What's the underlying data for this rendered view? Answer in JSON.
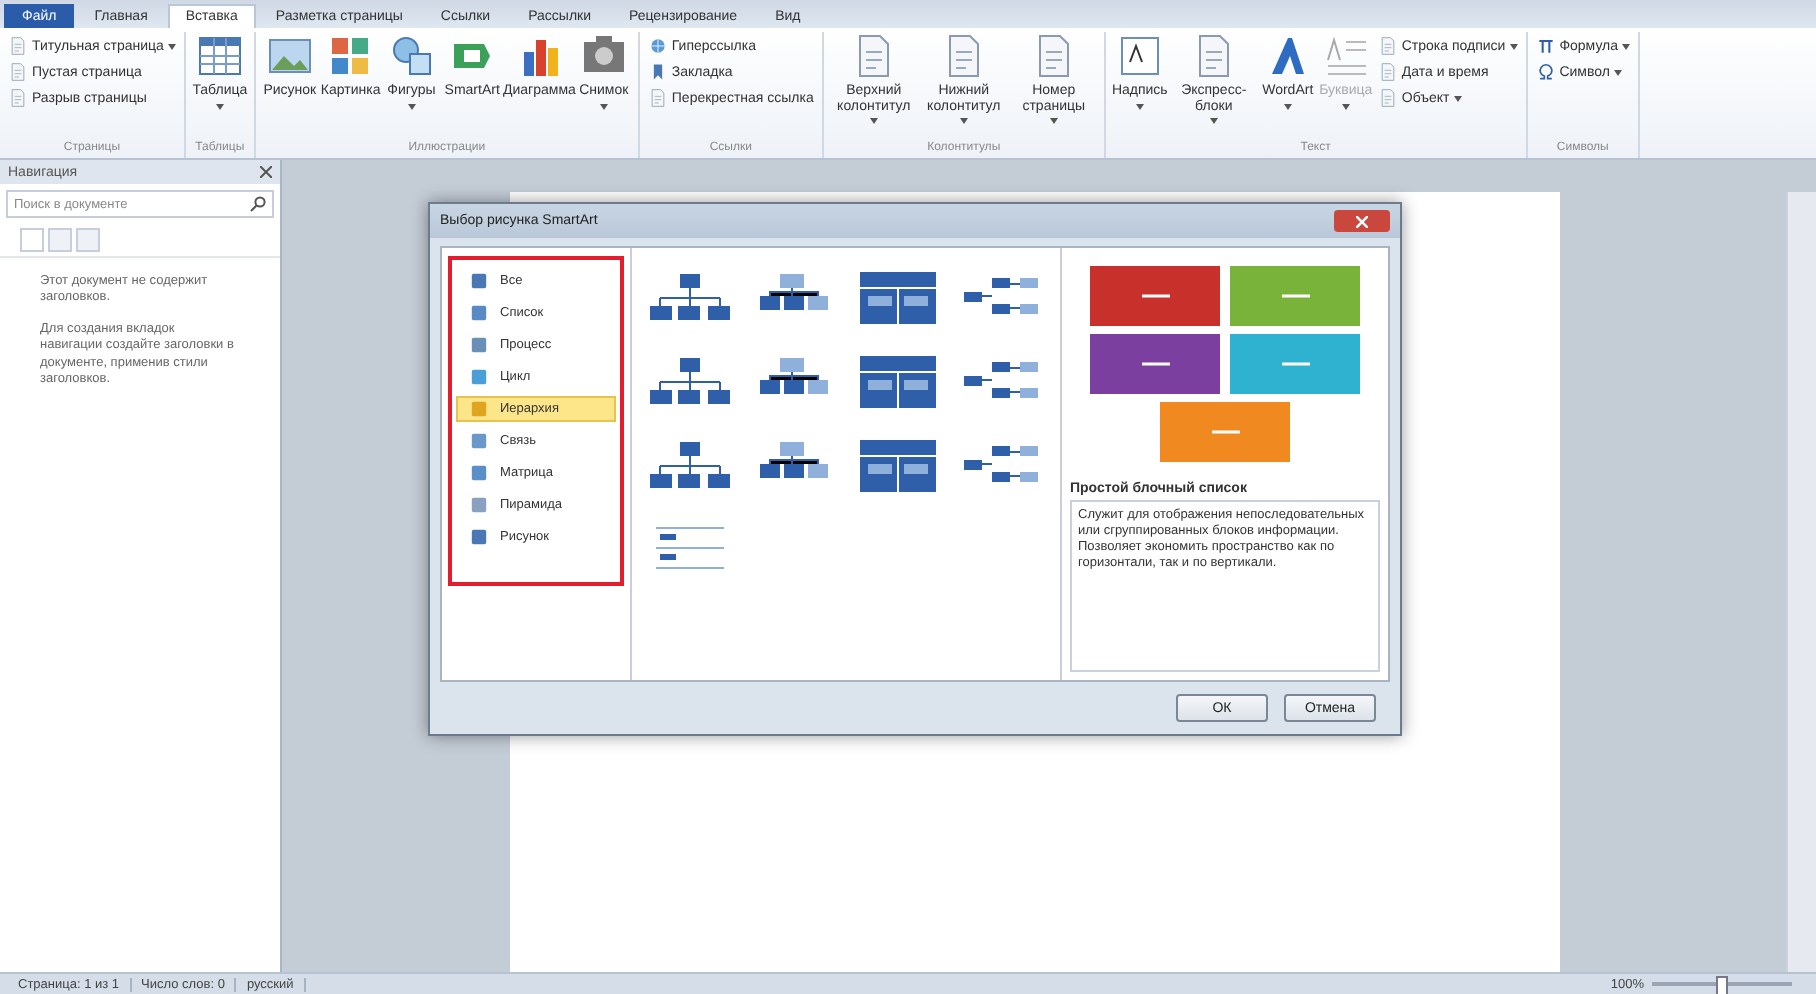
{
  "tabs": [
    {
      "label": "Файл",
      "kind": "file",
      "selected": false
    },
    {
      "label": "Главная",
      "kind": "tab",
      "selected": false
    },
    {
      "label": "Вставка",
      "kind": "tab",
      "selected": true
    },
    {
      "label": "Разметка страницы",
      "kind": "tab",
      "selected": false
    },
    {
      "label": "Ссылки",
      "kind": "tab",
      "selected": false
    },
    {
      "label": "Рассылки",
      "kind": "tab",
      "selected": false
    },
    {
      "label": "Рецензирование",
      "kind": "tab",
      "selected": false
    },
    {
      "label": "Вид",
      "kind": "tab",
      "selected": false
    }
  ],
  "ribbon": [
    {
      "label": "Страницы",
      "items": [
        {
          "kind": "small",
          "label": "Титульная страница",
          "dropdown": true
        },
        {
          "kind": "small",
          "label": "Пустая страница",
          "dropdown": false
        },
        {
          "kind": "small",
          "label": "Разрыв страницы",
          "dropdown": false
        }
      ]
    },
    {
      "label": "Таблицы",
      "items": [
        {
          "kind": "large",
          "label": "Таблица",
          "dropdown": true
        }
      ]
    },
    {
      "label": "Иллюстрации",
      "items": [
        {
          "kind": "large",
          "label": "Рисунок",
          "dropdown": false
        },
        {
          "kind": "large",
          "label": "Картинка",
          "dropdown": false
        },
        {
          "kind": "large",
          "label": "Фигуры",
          "dropdown": true
        },
        {
          "kind": "large",
          "label": "SmartArt",
          "dropdown": false
        },
        {
          "kind": "large",
          "label": "Диаграмма",
          "dropdown": false
        },
        {
          "kind": "large",
          "label": "Снимок",
          "dropdown": true
        }
      ]
    },
    {
      "label": "Ссылки",
      "items": [
        {
          "kind": "small",
          "label": "Гиперссылка",
          "dropdown": false
        },
        {
          "kind": "small",
          "label": "Закладка",
          "dropdown": false
        },
        {
          "kind": "small",
          "label": "Перекрестная ссылка",
          "dropdown": false
        }
      ]
    },
    {
      "label": "Колонтитулы",
      "items": [
        {
          "kind": "large",
          "label": "Верхний колонтитул",
          "dropdown": true
        },
        {
          "kind": "large",
          "label": "Нижний колонтитул",
          "dropdown": true
        },
        {
          "kind": "large",
          "label": "Номер страницы",
          "dropdown": true
        }
      ]
    },
    {
      "label": "Текст",
      "items": [
        {
          "kind": "large",
          "label": "Надпись",
          "dropdown": true
        },
        {
          "kind": "large",
          "label": "Экспресс-блоки",
          "dropdown": true
        },
        {
          "kind": "large",
          "label": "WordArt",
          "dropdown": true
        },
        {
          "kind": "large",
          "label": "Буквица",
          "dropdown": true,
          "disabled": true
        },
        {
          "kind": "small",
          "label": "Строка подписи",
          "dropdown": true
        },
        {
          "kind": "small",
          "label": "Дата и время",
          "dropdown": false
        },
        {
          "kind": "small",
          "label": "Объект",
          "dropdown": true
        }
      ]
    },
    {
      "label": "Символы",
      "items": [
        {
          "kind": "small",
          "label": "Формула",
          "dropdown": true
        },
        {
          "kind": "small",
          "label": "Символ",
          "dropdown": true
        }
      ]
    }
  ],
  "navigation": {
    "title": "Навигация",
    "search_placeholder": "Поиск в документе",
    "messages": [
      "Этот документ не содержит заголовков.",
      "Для создания вкладок навигации создайте заголовки в документе, применив стили заголовков."
    ]
  },
  "dialog": {
    "title": "Выбор рисунка SmartArt",
    "categories": [
      {
        "label": "Все",
        "selected": false
      },
      {
        "label": "Список",
        "selected": false
      },
      {
        "label": "Процесс",
        "selected": false
      },
      {
        "label": "Цикл",
        "selected": false
      },
      {
        "label": "Иерархия",
        "selected": true
      },
      {
        "label": "Связь",
        "selected": false
      },
      {
        "label": "Матрица",
        "selected": false
      },
      {
        "label": "Пирамида",
        "selected": false
      },
      {
        "label": "Рисунок",
        "selected": false
      }
    ],
    "preview_title": "Простой блочный список",
    "preview_description": "Служит для отображения непоследовательных или сгруппированных блоков информации. Позволяет экономить пространство как по горизонтали, так и по вертикали.",
    "buttons": [
      "ОК",
      "Отмена"
    ]
  },
  "status_bar": {
    "items": [
      "Страница: 1 из 1",
      "Число слов: 0",
      "русский"
    ],
    "zoom": "100%",
    "zoom_level": {
      "level": 0.5
    }
  }
}
